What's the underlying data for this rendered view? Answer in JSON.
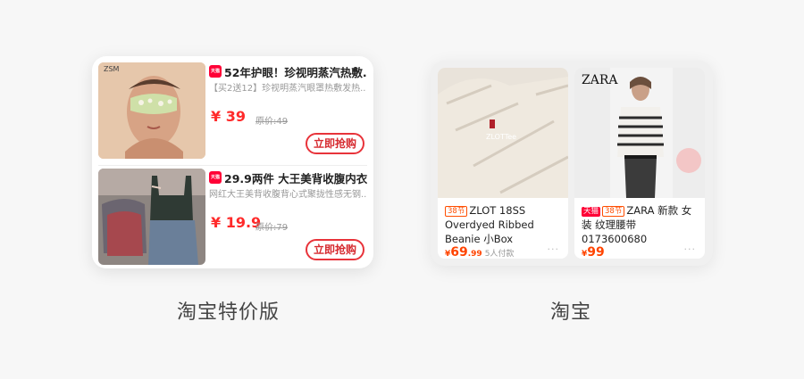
{
  "left_app": {
    "caption": "淘宝特价版",
    "items": [
      {
        "tag": "天猫",
        "title": "52年护眼！珍视明蒸汽热敷...",
        "subtitle": "【买2送12】珍视明蒸汽眼罩热敷发热...",
        "price": "¥ 39",
        "original_price": "原价:49",
        "buy_label": "立即抢购",
        "logo_text": "ZSM"
      },
      {
        "tag": "天猫",
        "title": "29.9两件  大王美背收腹内衣...",
        "subtitle": "网红大王美背收腹背心式聚拢性感无钢...",
        "price": "¥ 19.9",
        "original_price": "原价:79",
        "buy_label": "立即抢购"
      }
    ]
  },
  "right_app": {
    "caption": "淘宝",
    "products": [
      {
        "tags": [
          "38节"
        ],
        "title": "ZLOT 18SS Overdyed Ribbed Beanie 小Box",
        "price_yen": "¥",
        "price_int": "69",
        "price_dec": ".99",
        "sales": "5人付款",
        "more": "···",
        "image_text": "ZLOTTee"
      },
      {
        "tags": [
          "天猫",
          "38节"
        ],
        "title": "ZARA 新款 女装 纹理腰带 0173600680",
        "price_yen": "¥",
        "price_int": "99",
        "price_dec": "",
        "sales": "",
        "more": "···",
        "brand_text": "ZARA"
      }
    ]
  },
  "colors": {
    "price_red": "#ff2a2a",
    "tmall_red": "#ff0036",
    "tag_orange": "#ff4d00",
    "background": "#f7f7f7"
  }
}
